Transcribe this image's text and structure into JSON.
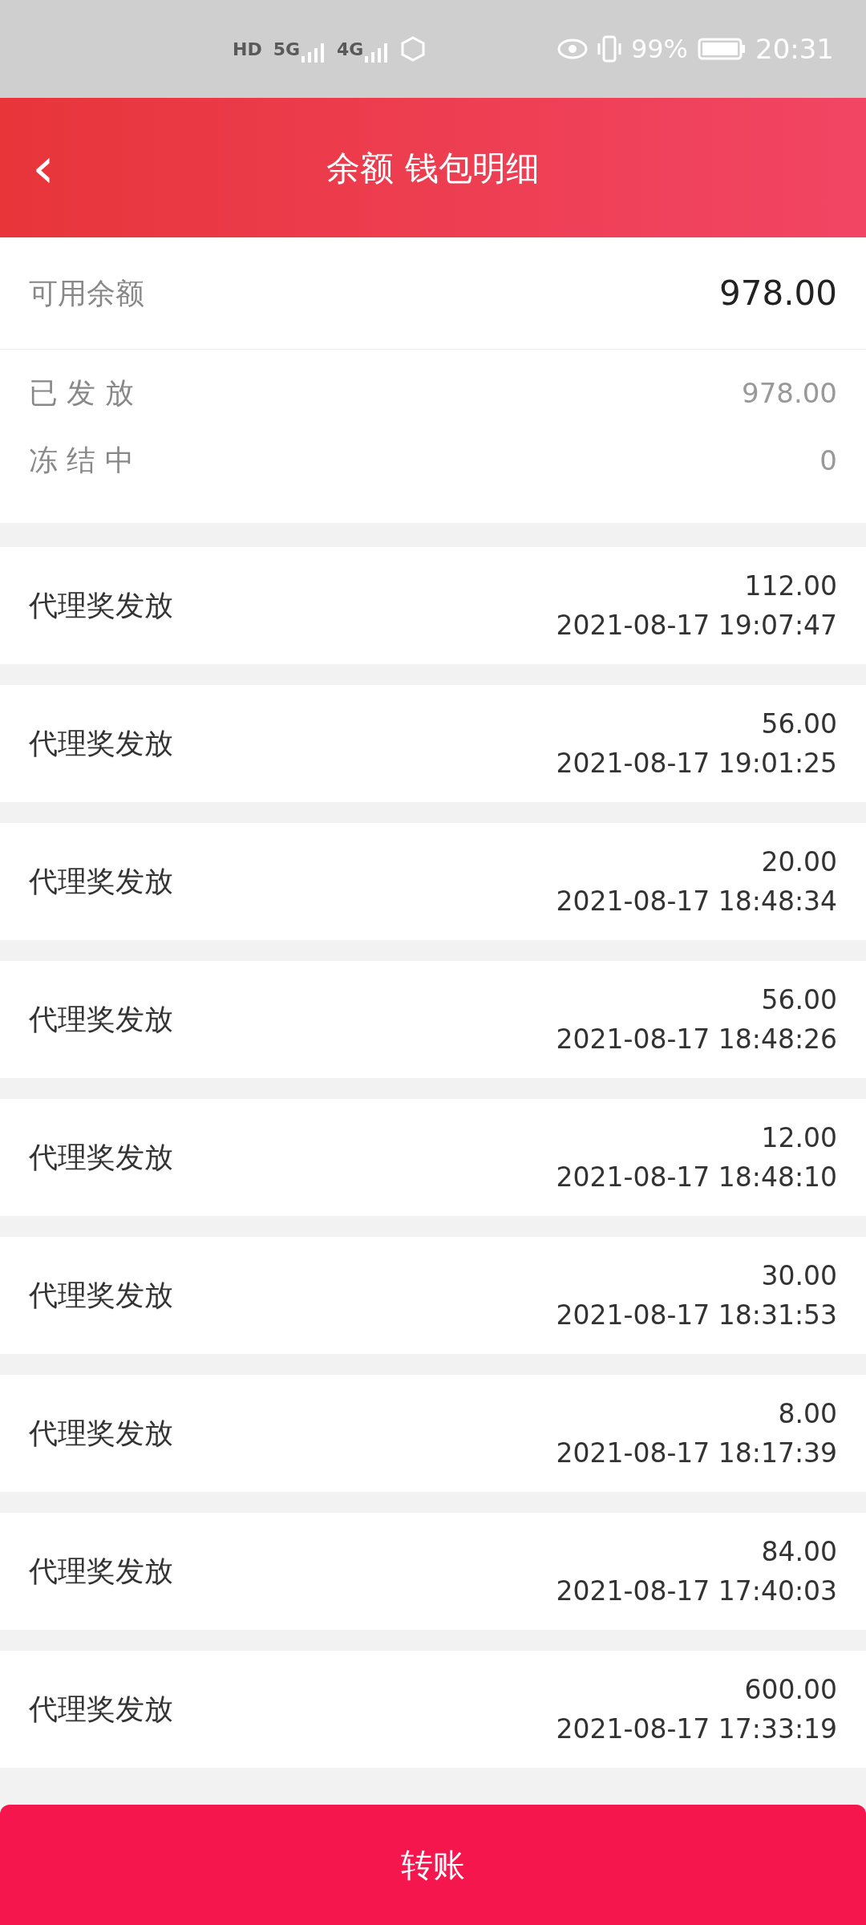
{
  "status_bar": {
    "network_labels": [
      "HD",
      "5G",
      "4G"
    ],
    "battery": "99%",
    "time": "20:31"
  },
  "header": {
    "back": "‹",
    "title": "余额 钱包明细"
  },
  "balance": {
    "available": {
      "label": "可用余额",
      "value": "978.00"
    },
    "rows": [
      {
        "label": "已 发 放",
        "value": "978.00"
      },
      {
        "label": "冻 结 中",
        "value": "0"
      }
    ]
  },
  "transactions": [
    {
      "title": "代理奖发放",
      "amount": "112.00",
      "time": "2021-08-17 19:07:47"
    },
    {
      "title": "代理奖发放",
      "amount": "56.00",
      "time": "2021-08-17 19:01:25"
    },
    {
      "title": "代理奖发放",
      "amount": "20.00",
      "time": "2021-08-17 18:48:34"
    },
    {
      "title": "代理奖发放",
      "amount": "56.00",
      "time": "2021-08-17 18:48:26"
    },
    {
      "title": "代理奖发放",
      "amount": "12.00",
      "time": "2021-08-17 18:48:10"
    },
    {
      "title": "代理奖发放",
      "amount": "30.00",
      "time": "2021-08-17 18:31:53"
    },
    {
      "title": "代理奖发放",
      "amount": "8.00",
      "time": "2021-08-17 18:17:39"
    },
    {
      "title": "代理奖发放",
      "amount": "84.00",
      "time": "2021-08-17 17:40:03"
    },
    {
      "title": "代理奖发放",
      "amount": "600.00",
      "time": "2021-08-17 17:33:19"
    }
  ],
  "transfer_button": "转账"
}
